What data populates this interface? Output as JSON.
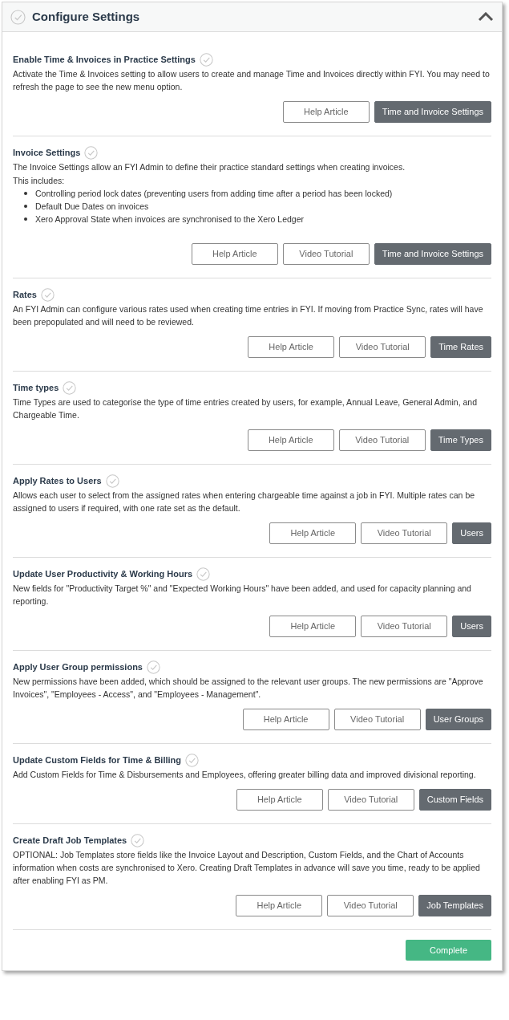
{
  "panel": {
    "title": "Configure Settings",
    "done": false,
    "expanded": true
  },
  "sections": [
    {
      "title": "Enable Time & Invoices in Practice Settings",
      "done": false,
      "text": [
        "Activate the Time & Invoices setting to allow users to create and manage Time and Invoices directly within FYI. You may need to refresh the page to see the new menu option."
      ],
      "buttons": [
        {
          "label": "Help Article",
          "kind": "outline"
        },
        {
          "label": "Time and Invoice Settings",
          "kind": "primary"
        }
      ]
    },
    {
      "title": "Invoice Settings",
      "done": false,
      "text": [
        "The Invoice Settings allow an FYI Admin to define their practice standard settings when creating invoices.",
        "This includes:"
      ],
      "bullets": [
        "Controlling period lock dates (preventing users from adding time after a period has been locked)",
        "Default Due Dates on invoices",
        "Xero Approval State when invoices are synchronised to the Xero Ledger"
      ],
      "buttons": [
        {
          "label": "Help Article",
          "kind": "outline"
        },
        {
          "label": "Video Tutorial",
          "kind": "outline"
        },
        {
          "label": "Time and Invoice Settings",
          "kind": "primary"
        }
      ]
    },
    {
      "title": "Rates",
      "done": false,
      "text": [
        "An FYI Admin can configure various rates used when creating time entries in FYI. If moving from Practice Sync, rates will have been prepopulated and will need to be reviewed."
      ],
      "buttons": [
        {
          "label": "Help Article",
          "kind": "outline"
        },
        {
          "label": "Video Tutorial",
          "kind": "outline"
        },
        {
          "label": "Time Rates",
          "kind": "primary"
        }
      ]
    },
    {
      "title": "Time types",
      "done": false,
      "text": [
        "Time Types are used to categorise the type of time entries created by users, for example, Annual Leave, General Admin, and Chargeable Time."
      ],
      "buttons": [
        {
          "label": "Help Article",
          "kind": "outline"
        },
        {
          "label": "Video Tutorial",
          "kind": "outline"
        },
        {
          "label": "Time Types",
          "kind": "primary"
        }
      ]
    },
    {
      "title": "Apply Rates to Users",
      "done": false,
      "text": [
        "Allows each user to select from the assigned rates when entering chargeable time against a job in FYI. Multiple rates can be assigned to users if required, with one rate set as the default."
      ],
      "buttons": [
        {
          "label": "Help Article",
          "kind": "outline"
        },
        {
          "label": "Video Tutorial",
          "kind": "outline"
        },
        {
          "label": "Users",
          "kind": "primary"
        }
      ]
    },
    {
      "title": "Update User Productivity & Working Hours",
      "done": false,
      "text": [
        "New fields for \"Productivity Target %\" and \"Expected Working Hours\" have been added, and used for capacity planning and reporting."
      ],
      "buttons": [
        {
          "label": "Help Article",
          "kind": "outline"
        },
        {
          "label": "Video Tutorial",
          "kind": "outline"
        },
        {
          "label": "Users",
          "kind": "primary"
        }
      ]
    },
    {
      "title": "Apply User Group permissions",
      "done": false,
      "text": [
        "New permissions have been added, which should be assigned to the relevant user groups. The new permissions are \"Approve Invoices\", \"Employees - Access\", and \"Employees - Management\"."
      ],
      "buttons": [
        {
          "label": "Help Article",
          "kind": "outline"
        },
        {
          "label": "Video Tutorial",
          "kind": "outline"
        },
        {
          "label": "User Groups",
          "kind": "primary"
        }
      ]
    },
    {
      "title": "Update Custom Fields for Time & Billing",
      "done": false,
      "text": [
        "Add Custom Fields for Time & Disbursements and Employees, offering greater billing data and improved divisional reporting."
      ],
      "buttons": [
        {
          "label": "Help Article",
          "kind": "outline"
        },
        {
          "label": "Video Tutorial",
          "kind": "outline"
        },
        {
          "label": "Custom Fields",
          "kind": "primary"
        }
      ]
    },
    {
      "title": "Create Draft Job Templates",
      "done": false,
      "text": [
        "OPTIONAL: Job Templates store fields like the Invoice Layout and Description, Custom Fields, and the Chart of Accounts information when costs are synchronised to Xero. Creating Draft Templates in advance will save you time, ready to be applied after enabling FYI as PM."
      ],
      "buttons": [
        {
          "label": "Help Article",
          "kind": "outline"
        },
        {
          "label": "Video Tutorial",
          "kind": "outline"
        },
        {
          "label": "Job Templates",
          "kind": "primary"
        }
      ]
    }
  ],
  "footer": {
    "button": "Complete"
  }
}
